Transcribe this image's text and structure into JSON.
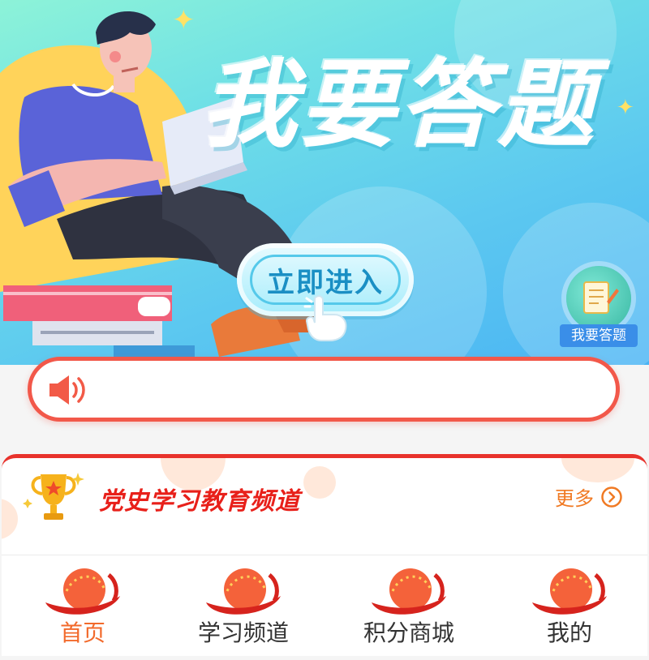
{
  "banner": {
    "headline": "我要答题",
    "enter_button": "立即进入",
    "quiz_badge_label": "我要答题"
  },
  "notice": {
    "text": ""
  },
  "channel": {
    "title": "党史学习教育频道",
    "more_label": "更多"
  },
  "tabbar": {
    "active_index": 0,
    "items": [
      {
        "label": "首页",
        "icon": "home-sun-icon"
      },
      {
        "label": "学习频道",
        "icon": "study-sun-icon"
      },
      {
        "label": "积分商城",
        "icon": "mall-sun-icon"
      },
      {
        "label": "我的",
        "icon": "profile-sun-icon"
      }
    ]
  },
  "colors": {
    "accent_red": "#e8322c",
    "accent_orange": "#f26a2b",
    "banner_teal": "#6fe0e6"
  }
}
